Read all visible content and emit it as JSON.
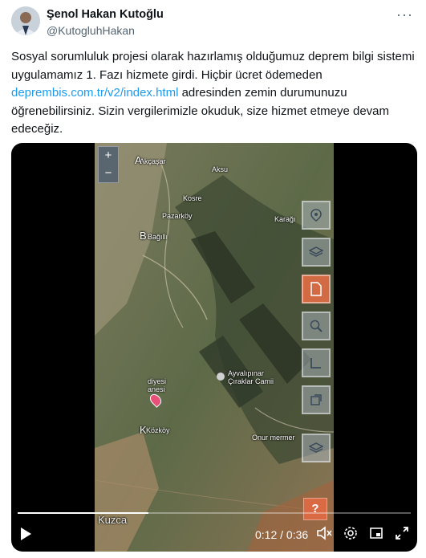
{
  "author": {
    "display_name": "Şenol Hakan Kutoğlu",
    "handle": "@KutogluhHakan",
    "avatar_icon": "profile-photo"
  },
  "more_menu": "···",
  "tweet": {
    "text_before_link": "Sosyal sorumluluk projesi olarak hazırlamış olduğumuz deprem bilgi sistemi uygulamamız 1. Fazı hizmete girdi. Hiçbir ücret ödemeden ",
    "link_text": "deprembis.com.tr/v2/index.html",
    "text_after_link": " adresinden zemin durumunuzu öğrenebilirsiniz. Sizin vergilerimizle okuduk, size hizmet etmeye devam edeceğiz."
  },
  "video": {
    "map_labels": {
      "akcasar": "Akçaşar",
      "aksu": "Aksu",
      "kosre": "Kosre",
      "pazarkoy": "Pazarköy",
      "karagi": "Karağı",
      "bagili": "Bağıllı",
      "ayvalipinar": "Ayvalıpınar Çıraklar Camii",
      "diyesi": "diyesi anesi",
      "kozkoy": "Közköy",
      "onur": "Onur mermer",
      "kuzca": "Kuzca",
      "big_a": "A",
      "big_b": "B",
      "big_k": "K"
    },
    "zoom_in": "+",
    "zoom_out": "−",
    "tool_icons": [
      "location-pin-icon",
      "layers-icon",
      "document-icon",
      "search-icon",
      "ruler-icon",
      "export-icon"
    ],
    "help_label": "?",
    "time_display": "0:12 / 0:36",
    "progress": 0.333,
    "colors": {
      "accent_link": "#1d9bf0",
      "tool_orange": "#e16e46"
    }
  }
}
